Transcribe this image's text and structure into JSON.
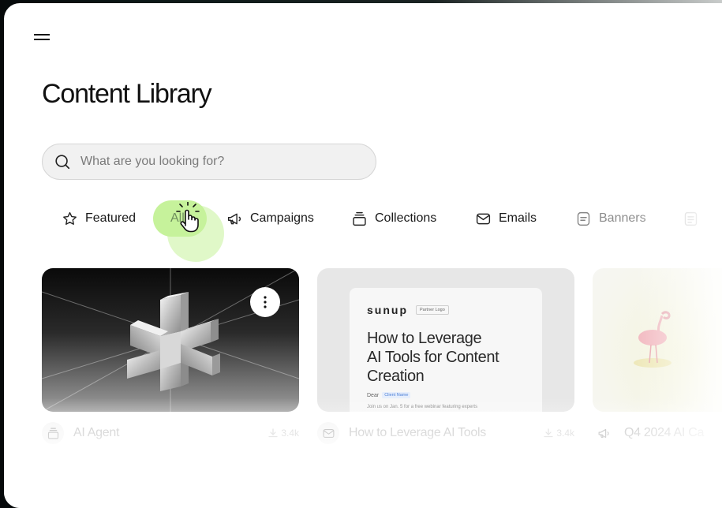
{
  "page": {
    "title": "Content Library"
  },
  "search": {
    "placeholder": "What are you looking for?",
    "value": ""
  },
  "tabs": [
    {
      "label": "Featured",
      "icon": "star-icon"
    },
    {
      "label": "All",
      "icon": "",
      "selected": true
    },
    {
      "label": "Campaigns",
      "icon": "megaphone-icon"
    },
    {
      "label": "Collections",
      "icon": "collections-icon"
    },
    {
      "label": "Emails",
      "icon": "envelope-icon"
    },
    {
      "label": "Banners",
      "icon": "banner-icon"
    },
    {
      "label": "",
      "icon": "document-icon"
    }
  ],
  "cards": [
    {
      "title": "AI Agent",
      "type_icon": "collections-icon",
      "downloads": "3.4k",
      "thumbnail": "3d-asterisk"
    },
    {
      "title": "How to Leverage AI Tools",
      "type_icon": "envelope-icon",
      "downloads": "3.4k",
      "email_preview": {
        "brand": "sunup",
        "partner_logo": "Partner Logo",
        "headline": "How to Leverage\nAI Tools for Content\nCreation",
        "dear": "Dear",
        "client_name": "Client Name",
        "body": "Join us on Jan. 5 for a free webinar featuring experts"
      }
    },
    {
      "title": "Q4 2024 AI Ca",
      "type_icon": "megaphone-icon",
      "downloads": "",
      "thumbnail": "flamingo"
    }
  ],
  "colors": {
    "accent": "#c6f29b",
    "text": "#111111",
    "muted": "#b3b3b3"
  }
}
